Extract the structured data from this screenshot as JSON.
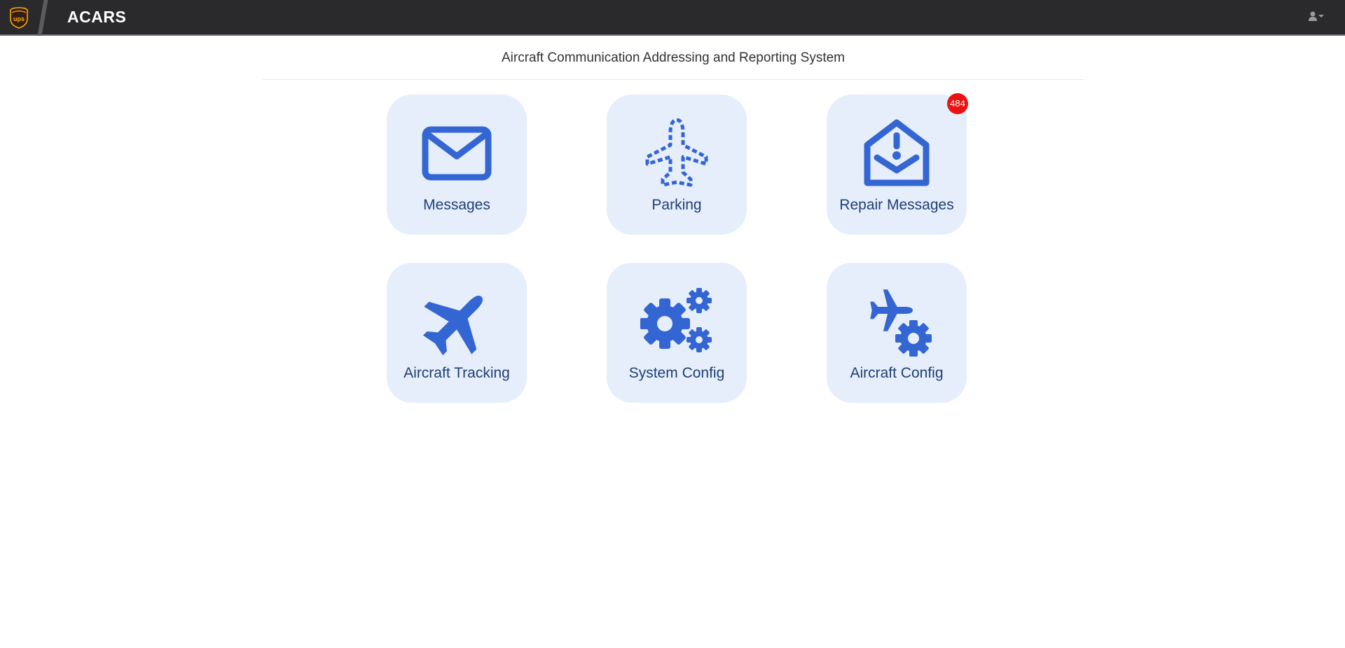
{
  "app": {
    "brand": "ACARS",
    "logo_text": "ups"
  },
  "header": {
    "title": "Aircraft Communication Addressing and Reporting System"
  },
  "user_menu": {
    "icon": "user-icon",
    "caret": "caret-down-icon"
  },
  "tiles": [
    {
      "label": "Messages",
      "icon": "envelope-icon"
    },
    {
      "label": "Parking",
      "icon": "plane-outline-icon"
    },
    {
      "label": "Repair Messages",
      "icon": "envelope-alert-icon",
      "badge": "484"
    },
    {
      "label": "Aircraft Tracking",
      "icon": "plane-icon"
    },
    {
      "label": "System Config",
      "icon": "gears-icon"
    },
    {
      "label": "Aircraft Config",
      "icon": "plane-gear-icon"
    }
  ],
  "colors": {
    "navbar": "#2a2a2d",
    "tile_bg": "#e6eefc",
    "icon": "#3466d3",
    "label": "#1f3f72",
    "badge": "#ee1111",
    "logo_gold": "#ffb500",
    "logo_brown": "#351c15"
  }
}
